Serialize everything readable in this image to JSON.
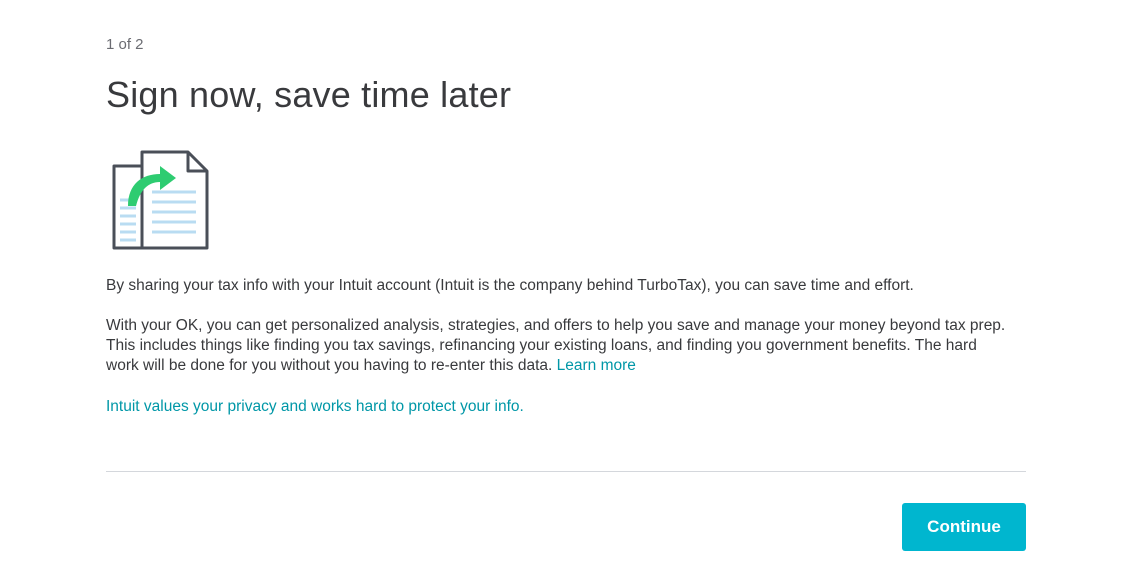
{
  "header": {
    "step": "1 of 2",
    "title": "Sign now, save time later"
  },
  "illustration": {
    "icon": "share-documents-icon",
    "accent_color": "#2ecc71",
    "outline_color": "#4a4f58",
    "line_color": "#b9dcf2"
  },
  "body": {
    "paragraph1": "By sharing your tax info with your Intuit account (Intuit is the company behind TurboTax), you can save time and effort.",
    "paragraph2": "With your OK, you can get personalized analysis, strategies, and offers to help you save and manage your money beyond tax prep. This includes things like finding you tax savings, refinancing your existing loans, and finding you government benefits. The hard work will be done for you without you having to re-enter this data.",
    "learn_more_label": "Learn more",
    "privacy_link": "Intuit values your privacy and works hard to protect your info."
  },
  "footer": {
    "continue_label": "Continue",
    "button_color": "#00b6cf"
  },
  "colors": {
    "link": "#0097a7",
    "text": "#393a3d"
  }
}
